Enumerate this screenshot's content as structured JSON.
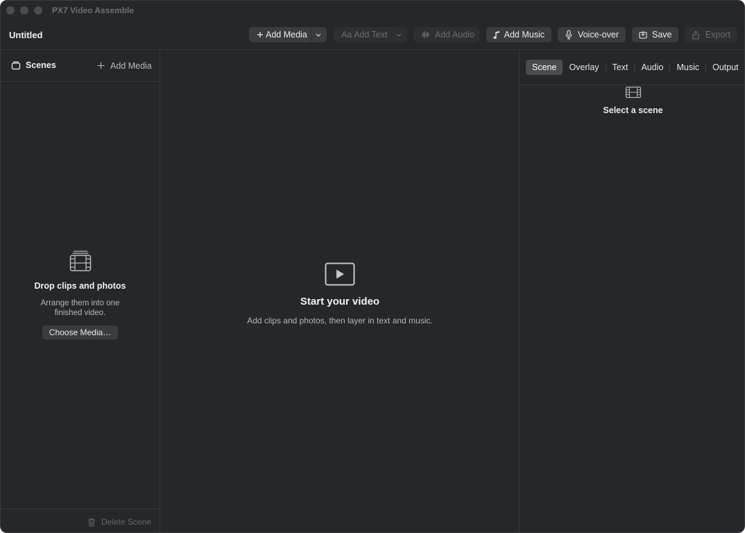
{
  "window": {
    "title": "PX7 Video Assemble"
  },
  "toolbar": {
    "document_title": "Untitled",
    "add_media": {
      "label": "Add Media",
      "icon": "plus-icon"
    },
    "add_text": {
      "label": "Aa Add Text",
      "enabled": false
    },
    "add_audio": {
      "label": "Add Audio",
      "icon": "audio-waves-icon",
      "enabled": false
    },
    "add_music": {
      "label": "Add Music",
      "icon": "music-note-icon"
    },
    "voice_over": {
      "label": "Voice-over",
      "icon": "microphone-icon"
    },
    "save": {
      "label": "Save",
      "icon": "save-icon"
    },
    "export": {
      "label": "Export",
      "icon": "share-icon",
      "enabled": false
    }
  },
  "sidebar": {
    "title": "Scenes",
    "add_label": "Add Media",
    "empty": {
      "heading": "Drop clips and photos",
      "body": "Arrange them into one finished video.",
      "button": "Choose Media…",
      "icon": "film-stack-icon"
    },
    "footer": {
      "delete_label": "Delete Scene",
      "icon": "trash-icon",
      "enabled": false
    }
  },
  "canvas": {
    "empty": {
      "heading": "Start your video",
      "body": "Add clips and photos, then layer in text and music.",
      "icon": "play-rectangle-icon"
    }
  },
  "inspector": {
    "tabs": [
      {
        "label": "Scene",
        "active": true
      },
      {
        "label": "Overlay",
        "active": false
      },
      {
        "label": "Text",
        "active": false
      },
      {
        "label": "Audio",
        "active": false
      },
      {
        "label": "Music",
        "active": false
      },
      {
        "label": "Output",
        "active": false
      }
    ],
    "empty": {
      "heading": "Select a scene",
      "icon": "film-icon"
    }
  },
  "colors": {
    "window_bg": "#25272b",
    "button_bg": "#3a3c41",
    "active_tab_bg": "#4a4c51",
    "divider": "#36383c"
  }
}
